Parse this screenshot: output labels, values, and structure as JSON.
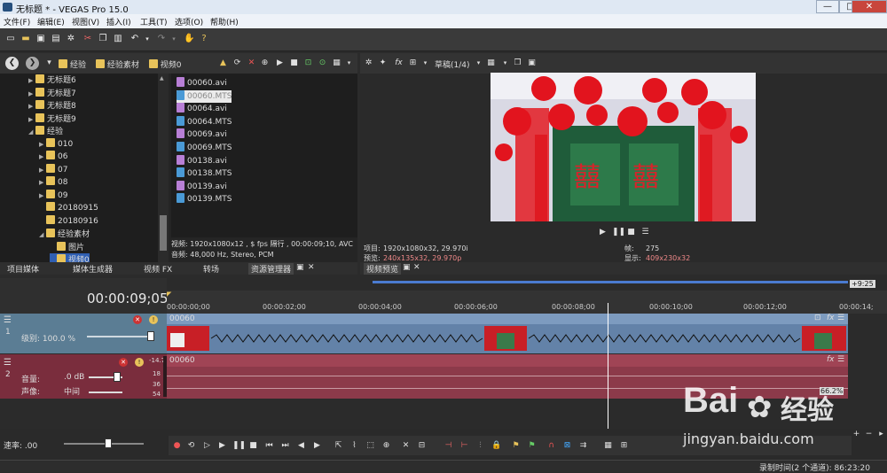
{
  "window": {
    "title": "无标题 * - VEGAS Pro 15.0",
    "min": "—",
    "max": "□",
    "close": "✕"
  },
  "menu": [
    "文件(F)",
    "编辑(E)",
    "视图(V)",
    "插入(I)",
    "工具(T)",
    "选项(O)",
    "帮助(H)"
  ],
  "explorer": {
    "breadcrumb": [
      "经验",
      "经验素材",
      "视频0"
    ],
    "tree": [
      {
        "label": "无标题6",
        "indent": 1,
        "arrow": "▶"
      },
      {
        "label": "无标题7",
        "indent": 1,
        "arrow": "▶"
      },
      {
        "label": "无标题8",
        "indent": 1,
        "arrow": "▶"
      },
      {
        "label": "无标题9",
        "indent": 1,
        "arrow": "▶"
      },
      {
        "label": "经验",
        "indent": 1,
        "arrow": "◢"
      },
      {
        "label": "010",
        "indent": 2,
        "arrow": "▶"
      },
      {
        "label": "06",
        "indent": 2,
        "arrow": "▶"
      },
      {
        "label": "07",
        "indent": 2,
        "arrow": "▶"
      },
      {
        "label": "08",
        "indent": 2,
        "arrow": "▶"
      },
      {
        "label": "09",
        "indent": 2,
        "arrow": "▶"
      },
      {
        "label": "20180915",
        "indent": 2,
        "arrow": ""
      },
      {
        "label": "20180916",
        "indent": 2,
        "arrow": ""
      },
      {
        "label": "经验素材",
        "indent": 2,
        "arrow": "◢"
      },
      {
        "label": "图片",
        "indent": 3,
        "arrow": ""
      },
      {
        "label": "视频0",
        "indent": 3,
        "arrow": "",
        "selected": true
      }
    ],
    "files": [
      {
        "name": "00060.avi",
        "type": "avi"
      },
      {
        "name": "00060.MTS",
        "type": "mts",
        "selected": true
      },
      {
        "name": "00064.avi",
        "type": "avi"
      },
      {
        "name": "00064.MTS",
        "type": "mts"
      },
      {
        "name": "00069.avi",
        "type": "avi"
      },
      {
        "name": "00069.MTS",
        "type": "mts"
      },
      {
        "name": "00138.avi",
        "type": "avi"
      },
      {
        "name": "00138.MTS",
        "type": "mts"
      },
      {
        "name": "00139.avi",
        "type": "avi"
      },
      {
        "name": "00139.MTS",
        "type": "mts"
      }
    ],
    "info_video": "视频: 1920x1080x12 , $ fps 隔行 , 00:00:09;10, AVC",
    "info_audio": "音频: 48,000 Hz, Stereo, PCM",
    "tabs": [
      "项目媒体",
      "媒体生成器",
      "视频 FX",
      "转场",
      "资源管理器"
    ]
  },
  "preview": {
    "quality": "草稿(1/4)",
    "project_label": "项目:",
    "project_val": "1920x1080x32, 29.970i",
    "preview_label": "预览:",
    "preview_val": "240x135x32, 29.970p",
    "frame_label": "帧:",
    "frame_val": "275",
    "display_label": "显示:",
    "display_val": "409x230x32",
    "tab": "视频预览"
  },
  "timeline": {
    "timecode": "00:00:09;05",
    "ruler": [
      "00:00:00;00",
      "00:00:02;00",
      "00:00:04;00",
      "00:00:06;00",
      "00:00:08;00",
      "00:00:10;00",
      "00:00:12;00",
      "00:00:14;"
    ],
    "end_marker": "+9:25",
    "video_track": {
      "number": "1",
      "level": "级别: 100.0 %",
      "clip": "00060"
    },
    "audio_track": {
      "number": "2",
      "volume_label": "音量:",
      "volume": ".0 dB",
      "pan_label": "声像:",
      "pan": "中间",
      "clip": "00060",
      "db_top": "-14.7",
      "db_marks": [
        "18",
        "36",
        "54"
      ],
      "percent": "66.2%"
    },
    "rate": "速率: .00",
    "playhead_fraction": 0.647
  },
  "status": {
    "record_time": "录制时间(2 个通道): 86:23:20"
  },
  "watermark": {
    "brand": "Bai",
    "brand2": "经验",
    "url": "jingyan.baidu.com"
  },
  "colors": {
    "video_track": "#6382a8",
    "audio_track": "#8c3a4a",
    "accent": "#e8c35a"
  }
}
